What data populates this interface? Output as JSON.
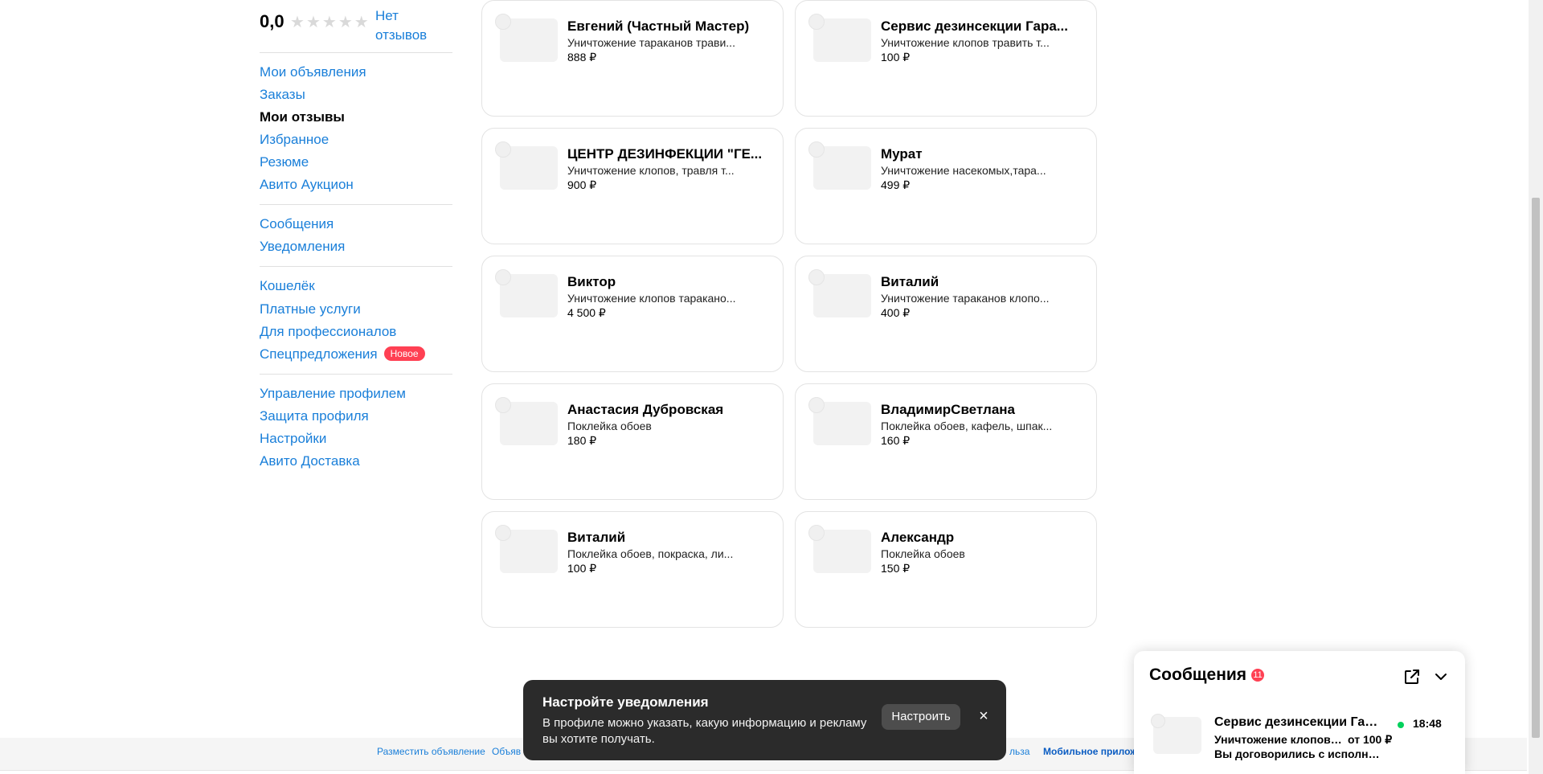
{
  "sidebar": {
    "rating": {
      "value": "0,0",
      "stars_total": 5,
      "stars_filled": 0,
      "no_reviews": "Нет отзывов"
    },
    "group1": [
      "Мои объявления",
      "Заказы",
      "Мои отзывы",
      "Избранное",
      "Резюме",
      "Авито Аукцион"
    ],
    "active_item": "Мои отзывы",
    "group2": [
      "Сообщения",
      "Уведомления"
    ],
    "group3": [
      "Кошелёк",
      "Платные услуги",
      "Для профессионалов",
      "Спецпредложения"
    ],
    "badge_new": "Новое",
    "group4": [
      "Управление профилем",
      "Защита профиля",
      "Настройки",
      "Авито Доставка"
    ]
  },
  "cards": [
    {
      "name": "Евгений (Частный Мастер)",
      "desc": "Уничтожение тараканов трави...",
      "price": "888 ₽"
    },
    {
      "name": "Сервис дезинсекции Гара...",
      "desc": "Уничтожение клопов травить т...",
      "price": "100 ₽"
    },
    {
      "name": "ЦЕНТР ДЕЗИНФЕКЦИИ \"ГЕ...",
      "desc": "Уничтожение клопов, травля т...",
      "price": "900 ₽"
    },
    {
      "name": "Мурат",
      "desc": "Уничтожение насекомых,тара...",
      "price": "499 ₽"
    },
    {
      "name": "Виктор",
      "desc": "Уничтожение клопов тараканo...",
      "price": "4 500 ₽"
    },
    {
      "name": "Виталий",
      "desc": "Уничтожение тараканов клопо...",
      "price": "400 ₽"
    },
    {
      "name": "Анастасия Дубровская",
      "desc": "Поклейка обоев",
      "price": "180 ₽"
    },
    {
      "name": "ВладимирСветлана",
      "desc": "Поклейка обоев, кафель, шпак...",
      "price": "160 ₽"
    },
    {
      "name": "Виталий",
      "desc": "Поклейка обоев, покраска, ли...",
      "price": "100 ₽"
    },
    {
      "name": "Александр",
      "desc": "Поклейка обоев",
      "price": "150 ₽"
    }
  ],
  "footer": {
    "links": [
      "Разместить объявление",
      "Объяв",
      "льза"
    ],
    "mobile": "Мобильное приложе"
  },
  "toast": {
    "title": "Настройте уведомления",
    "text": "В профиле можно указать, какую информацию и рекламу вы хотите получать.",
    "button": "Настроить",
    "close": "×"
  },
  "messenger": {
    "title": "Сообщения",
    "unread_count": "11",
    "chat": {
      "name": "Сервис дезинсекции Гар...",
      "time": "18:48",
      "subject": "Уничтожение клопов т...",
      "price": "от 100 ₽",
      "last_message": "Вы договорились с исполните..."
    }
  },
  "colors": {
    "link": "#1a7fd9",
    "badge": "#ff4053",
    "toast_bg": "#2b2b2b",
    "online": "#02d15c"
  }
}
